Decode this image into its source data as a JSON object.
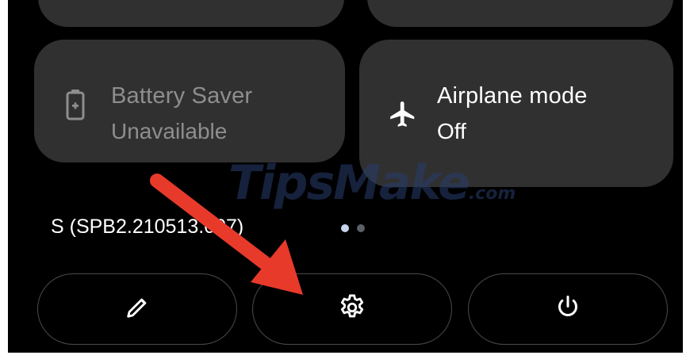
{
  "tiles": {
    "battery_saver": {
      "title": "Battery Saver",
      "status": "Unavailable",
      "icon": "battery-icon"
    },
    "airplane_mode": {
      "title": "Airplane mode",
      "status": "Off",
      "icon": "airplane-icon"
    }
  },
  "build_number": "S (SPB2.210513.007)",
  "page_indicator": {
    "count": 2,
    "active": 0
  },
  "buttons": {
    "edit": {
      "icon": "pencil-icon"
    },
    "settings": {
      "icon": "gear-icon"
    },
    "power": {
      "icon": "power-icon"
    }
  },
  "watermark": {
    "main": "TipsMake",
    "suffix": ".com"
  },
  "colors": {
    "tile_bg": "#303030",
    "active_dot": "#c7d6ee",
    "inactive_dot": "#5b5f66",
    "arrow": "#e83a2b"
  }
}
